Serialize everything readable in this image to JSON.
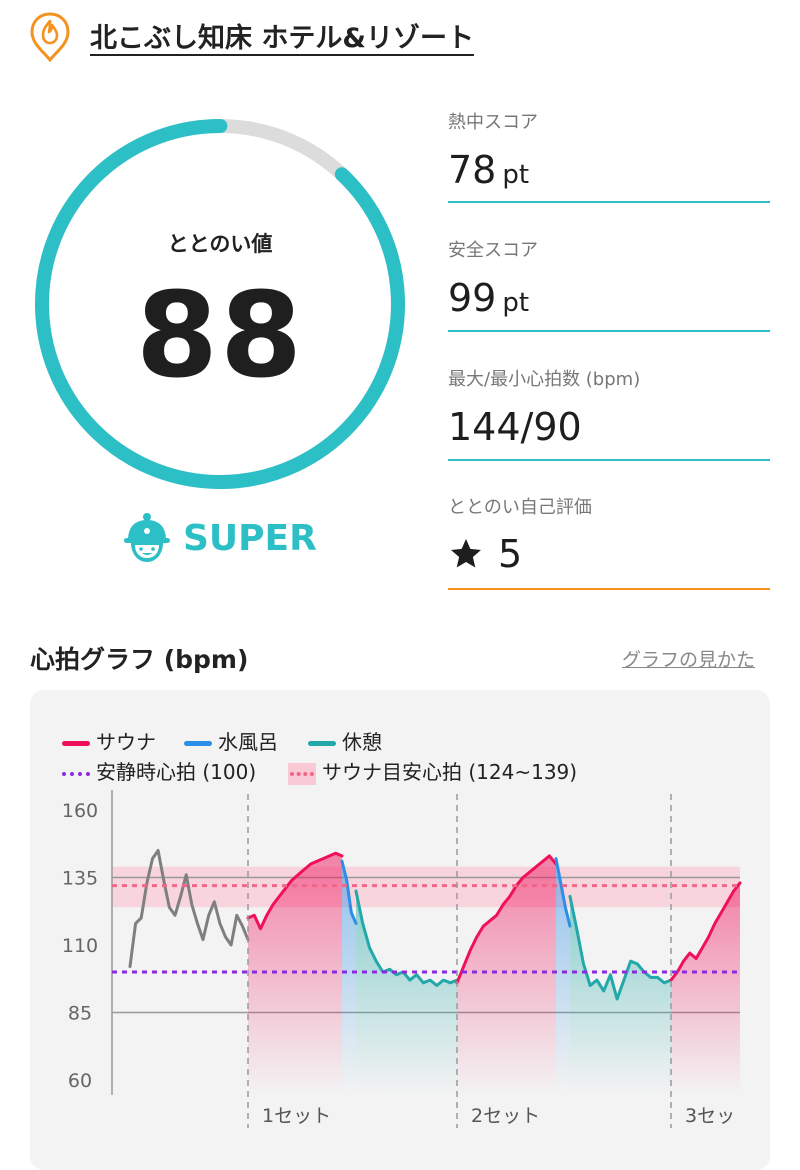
{
  "header": {
    "facility_name": "北こぶし知床 ホテル&リゾート",
    "icon": "sauna-flame-pin-icon"
  },
  "gauge": {
    "label": "ととのい値",
    "value": "88",
    "progress_fraction": 0.88,
    "colors": {
      "fill": "#2dbfc6",
      "track": "#dcdcdc"
    }
  },
  "rank": {
    "icon": "mascot-hat-icon",
    "label": "SUPER",
    "color": "#2dbfc6"
  },
  "stats": [
    {
      "label": "熱中スコア",
      "value": "78",
      "unit": "pt",
      "line_color": "#2dbfc6"
    },
    {
      "label": "安全スコア",
      "value": "99",
      "unit": "pt",
      "line_color": "#2dbfc6"
    },
    {
      "label": "最大/最小心拍数 (bpm)",
      "value": "144/90",
      "unit": "",
      "line_color": "#2dbfc6"
    },
    {
      "label": "ととのい自己評価",
      "value": "5",
      "icon": "star-icon",
      "unit": "",
      "line_color": "#f5911e"
    }
  ],
  "graph": {
    "title": "心拍グラフ (bpm)",
    "help_link": "グラフの見かた",
    "legend": {
      "sauna": "サウナ",
      "cold_bath": "水風呂",
      "rest": "休憩",
      "resting_hr": "安静時心拍 (100)",
      "sauna_target": "サウナ目安心拍 (124~139)"
    },
    "colors": {
      "sauna": "#f0105a",
      "cold_bath": "#2b8ee8",
      "rest": "#22a8a8",
      "baseline": "#7f7f7f",
      "resting": "#8a2be2",
      "target": "#f06688"
    }
  },
  "chart_data": {
    "type": "line",
    "ylim": [
      60,
      160
    ],
    "yticks": [
      "160",
      "135",
      "110",
      "85",
      "60"
    ],
    "x_labels": [
      "1セット",
      "2セット",
      "3セッ"
    ],
    "resting_hr": 100,
    "target_band": [
      124,
      139
    ],
    "target_line": 132,
    "series": [
      {
        "name": "サウナ",
        "segment": "baseline",
        "values": [
          102,
          118,
          120,
          133,
          142,
          145,
          134,
          124,
          121,
          128,
          136,
          125,
          118,
          112,
          121,
          126,
          118,
          113,
          110,
          121,
          117,
          112
        ]
      },
      {
        "name": "サウナ",
        "segment": "sauna",
        "values": [
          120,
          121,
          116,
          121,
          125,
          128,
          131,
          134,
          136,
          138,
          140,
          141,
          142,
          143,
          144,
          143
        ]
      },
      {
        "name": "水風呂",
        "segment": "cold",
        "values": [
          141,
          134,
          122,
          118
        ]
      },
      {
        "name": "休憩",
        "segment": "rest",
        "values": [
          130,
          118,
          109,
          104,
          100,
          101,
          99,
          100,
          97,
          99,
          96,
          97,
          95,
          97,
          96,
          97
        ]
      },
      {
        "name": "サウナ",
        "segment": "sauna",
        "values": [
          96,
          102,
          108,
          113,
          117,
          119,
          121,
          125,
          128,
          132,
          135,
          137,
          139,
          141,
          143,
          140
        ]
      },
      {
        "name": "水風呂",
        "segment": "cold",
        "values": [
          142,
          133,
          124,
          117
        ]
      },
      {
        "name": "休憩",
        "segment": "rest",
        "values": [
          128,
          116,
          103,
          95,
          97,
          93,
          99,
          90,
          97,
          104,
          103,
          100,
          98,
          98,
          96,
          97
        ]
      },
      {
        "name": "サウナ",
        "segment": "sauna",
        "values": [
          97,
          100,
          104,
          107,
          105,
          109,
          113,
          118,
          122,
          126,
          130,
          133
        ]
      }
    ]
  }
}
